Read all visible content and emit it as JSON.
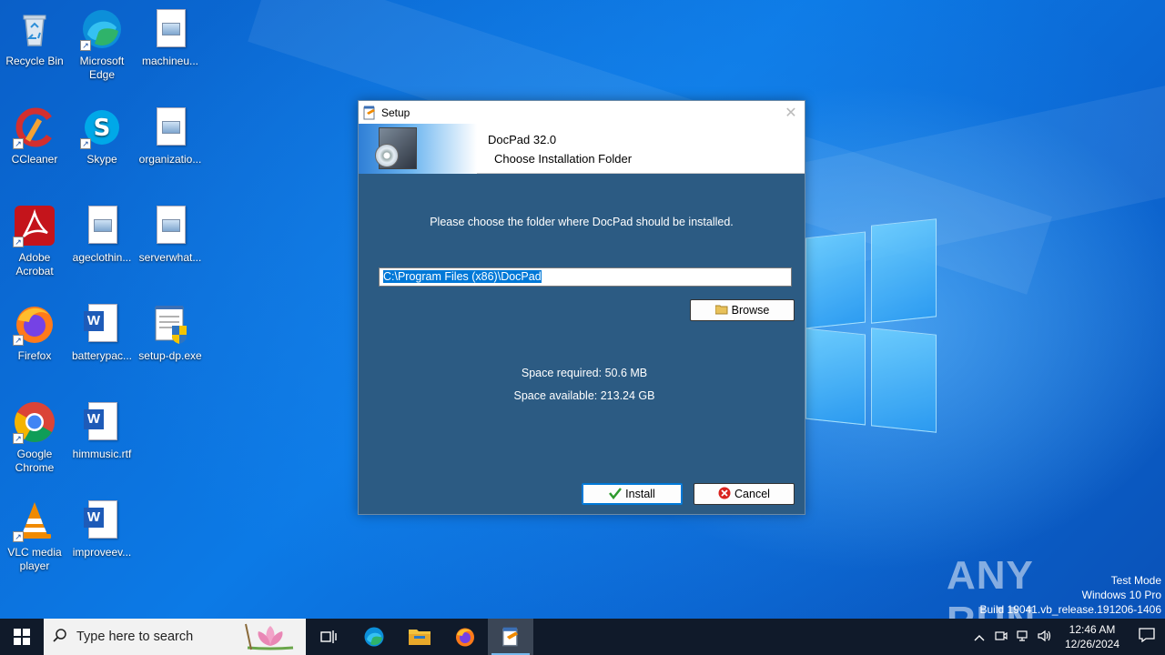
{
  "desktop": {
    "icons": [
      {
        "label": "Recycle Bin"
      },
      {
        "label": "Microsoft Edge"
      },
      {
        "label": "machineu..."
      },
      {
        "label": "CCleaner"
      },
      {
        "label": "Skype"
      },
      {
        "label": "organizatio..."
      },
      {
        "label": "Adobe Acrobat"
      },
      {
        "label": "ageclothin..."
      },
      {
        "label": "serverwhat..."
      },
      {
        "label": "Firefox"
      },
      {
        "label": "batterypac..."
      },
      {
        "label": "setup-dp.exe"
      },
      {
        "label": "Google Chrome"
      },
      {
        "label": "himmusic.rtf"
      },
      {
        "label": "VLC media player"
      },
      {
        "label": "improveev..."
      }
    ]
  },
  "setup": {
    "window_title": "Setup",
    "close_glyph": "✕",
    "product_name": "DocPad 32.0",
    "subtitle": "Choose Installation Folder",
    "prompt": "Please choose the folder where DocPad should be installed.",
    "install_path": "C:\\Program Files (x86)\\DocPad",
    "browse_label": "Browse",
    "space_required": "Space required: 50.6 MB",
    "space_available": "Space available: 213.24 GB",
    "install_label": "Install",
    "cancel_label": "Cancel"
  },
  "watermark": {
    "text": "ANY RUN",
    "line1": "Test Mode",
    "line2": "Windows 10 Pro",
    "line3": "Build 19041.vb_release.191206-1406"
  },
  "taskbar": {
    "search_placeholder": "Type here to search",
    "time": "12:46 AM",
    "date": "12/26/2024"
  }
}
